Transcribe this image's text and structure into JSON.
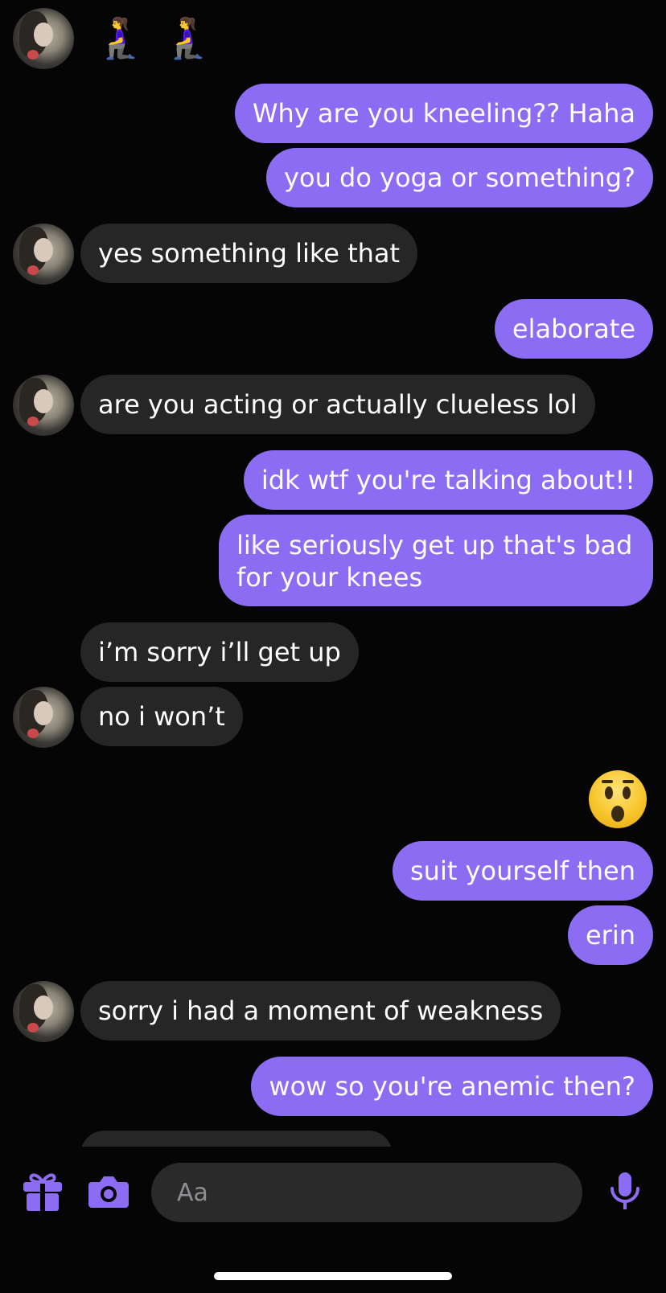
{
  "colors": {
    "outgoing_bubble": "#8b6cf2",
    "incoming_bubble": "#262626",
    "accent_icon": "#8b6cf2",
    "background": "#050505"
  },
  "header_emojis": [
    "🧎‍♀️",
    "🧎‍♀️"
  ],
  "messages": [
    {
      "text": "Why are you kneeling?? Haha",
      "direction": "out"
    },
    {
      "text": "you do yoga or something?",
      "direction": "out"
    },
    {
      "text": "yes something like that",
      "direction": "in"
    },
    {
      "text": "elaborate",
      "direction": "out"
    },
    {
      "text": "are you acting or actually clueless lol",
      "direction": "in"
    },
    {
      "text": "idk wtf you're talking about!!",
      "direction": "out"
    },
    {
      "text": "like seriously get up that's bad for your knees",
      "direction": "out"
    },
    {
      "text": "i’m sorry i’ll get up",
      "direction": "in"
    },
    {
      "text": "no i won’t",
      "direction": "in"
    },
    {
      "emoji": "astonished-face",
      "direction": "out"
    },
    {
      "text": "suit yourself then",
      "direction": "out"
    },
    {
      "text": "erin",
      "direction": "out"
    },
    {
      "text": "sorry i had a moment of weakness",
      "direction": "in"
    },
    {
      "text": "wow so you're anemic then?",
      "direction": "out"
    }
  ],
  "composer": {
    "placeholder": "Aa",
    "icons": [
      "gift-icon",
      "camera-icon",
      "microphone-icon"
    ]
  }
}
